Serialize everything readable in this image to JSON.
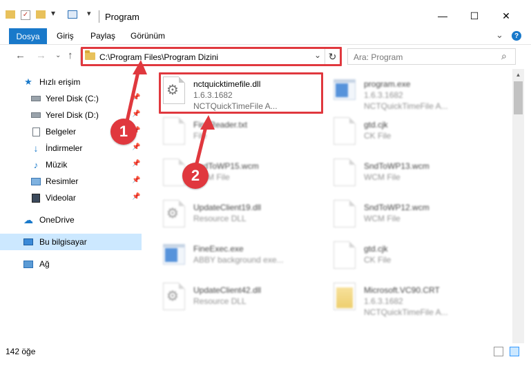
{
  "window": {
    "title": "Program",
    "minimize": "—",
    "maximize": "☐",
    "close": "✕"
  },
  "ribbon": {
    "tabs": [
      "Dosya",
      "Giriş",
      "Paylaş",
      "Görünüm"
    ],
    "help": "?"
  },
  "nav": {
    "address_path": "C:\\Program Files\\Program Dizini",
    "search_placeholder": "Ara: Program"
  },
  "sidebar": {
    "quick_access": "Hızlı erişim",
    "items": [
      {
        "label": "Yerel Disk (C:)",
        "icon": "drive-icon"
      },
      {
        "label": "Yerel Disk (D:)",
        "icon": "drive-icon"
      },
      {
        "label": "Belgeler",
        "icon": "documents-icon"
      },
      {
        "label": "İndirmeler",
        "icon": "downloads-icon"
      },
      {
        "label": "Müzik",
        "icon": "music-icon"
      },
      {
        "label": "Resimler",
        "icon": "pictures-icon"
      },
      {
        "label": "Videolar",
        "icon": "videos-icon"
      }
    ],
    "onedrive": "OneDrive",
    "this_pc": "Bu bilgisayar",
    "network": "Ağ"
  },
  "files": {
    "left": [
      {
        "name": "nctquicktimefile.dll",
        "line2": "1.6.3.1682",
        "line3": "NCTQuickTimeFile   A...",
        "icon": "dll-icon",
        "blurred": false
      },
      {
        "name": "FineReader.txt",
        "line2": "File",
        "line3": "",
        "icon": "file-icon",
        "blurred": true
      },
      {
        "name": "SndToWP15.wcm",
        "line2": "WCM File",
        "line3": "",
        "icon": "file-icon",
        "blurred": true
      },
      {
        "name": "UpdateClient19.dll",
        "line2": "Resource DLL",
        "line3": "",
        "icon": "dll-icon",
        "blurred": true
      },
      {
        "name": "FineExec.exe",
        "line2": "ABBY background exe...",
        "line3": "",
        "icon": "exe-icon",
        "blurred": true
      },
      {
        "name": "UpdateClient42.dll",
        "line2": "Resource DLL",
        "line3": "",
        "icon": "dll-icon",
        "blurred": true
      }
    ],
    "right": [
      {
        "name": "program.exe",
        "line2": "1.6.3.1682",
        "line3": "NCTQuickTimeFile   A...",
        "icon": "exe-icon",
        "blurred": true
      },
      {
        "name": "gtd.cjk",
        "line2": "CK File",
        "line3": "",
        "icon": "file-icon",
        "blurred": true
      },
      {
        "name": "SndToWP13.wcm",
        "line2": "WCM File",
        "line3": "",
        "icon": "file-icon",
        "blurred": true
      },
      {
        "name": "SndToWP12.wcm",
        "line2": "WCM File",
        "line3": "",
        "icon": "file-icon",
        "blurred": true
      },
      {
        "name": "gtd.cjk",
        "line2": "CK File",
        "line3": "",
        "icon": "file-icon",
        "blurred": true
      },
      {
        "name": "Microsoft.VC90.CRT",
        "line2": "1.6.3.1682",
        "line3": "NCTQuickTimeFile   A...",
        "icon": "folder-file-icon",
        "blurred": true
      }
    ]
  },
  "status": {
    "count": "142 öğe"
  },
  "annotations": {
    "badge1": "1",
    "badge2": "2",
    "color": "#e0383e"
  }
}
